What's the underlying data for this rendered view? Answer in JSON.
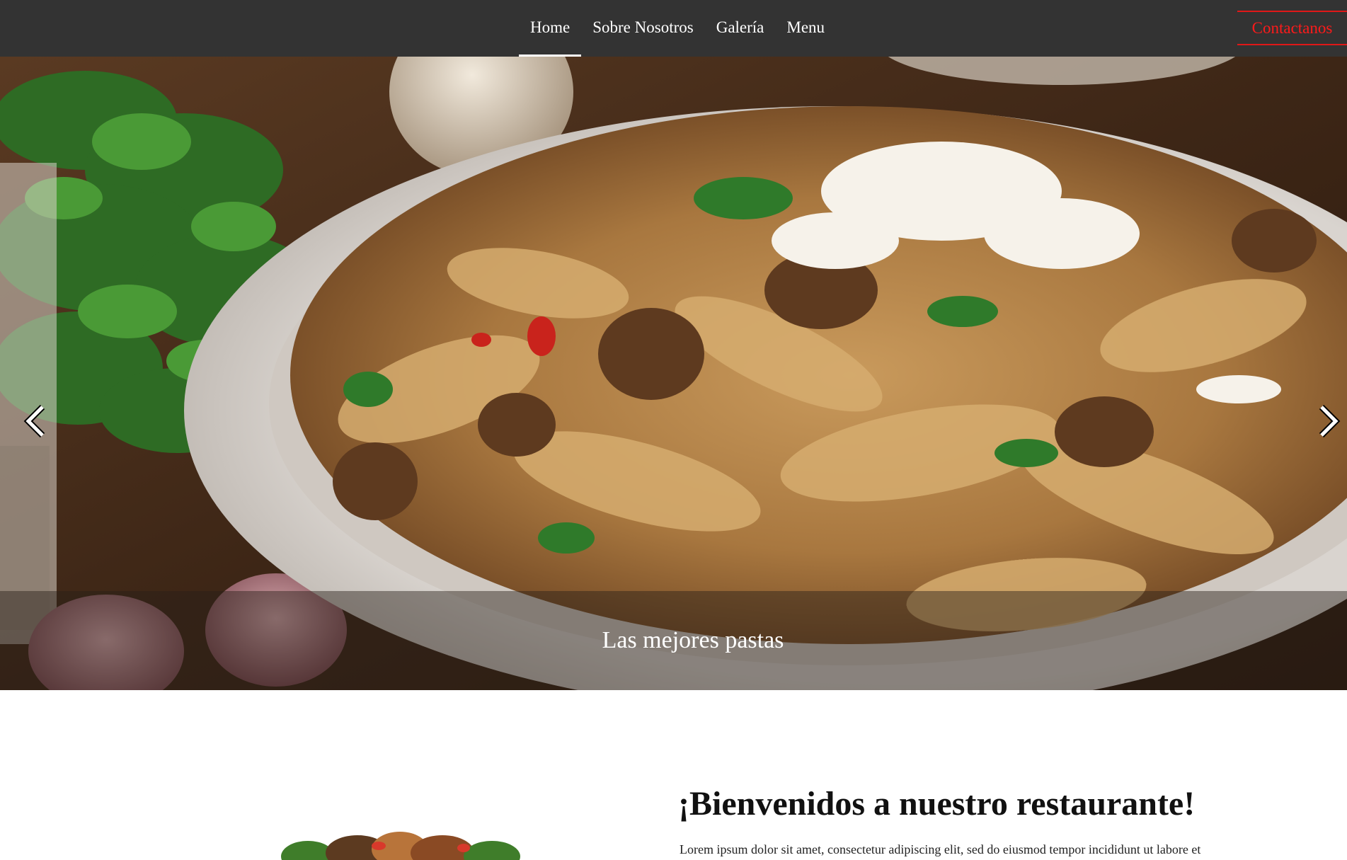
{
  "navbar": {
    "links": [
      {
        "label": "Home",
        "active": true
      },
      {
        "label": "Sobre Nosotros",
        "active": false
      },
      {
        "label": "Galería",
        "active": false
      },
      {
        "label": "Menu",
        "active": false
      }
    ],
    "contact_label": "Contactanos"
  },
  "hero": {
    "caption": "Las mejores pastas",
    "prev_icon": "chevron-left-icon",
    "next_icon": "chevron-right-icon"
  },
  "welcome": {
    "title": "¡Bienvenidos a nuestro restaurante!",
    "text": "Lorem ipsum dolor sit amet, consectetur adipiscing elit, sed do eiusmod tempor incididunt ut labore et"
  },
  "colors": {
    "navbar_bg": "#333333",
    "accent_red": "#e01818",
    "caption_overlay": "rgba(40,30,25,0.45)"
  }
}
